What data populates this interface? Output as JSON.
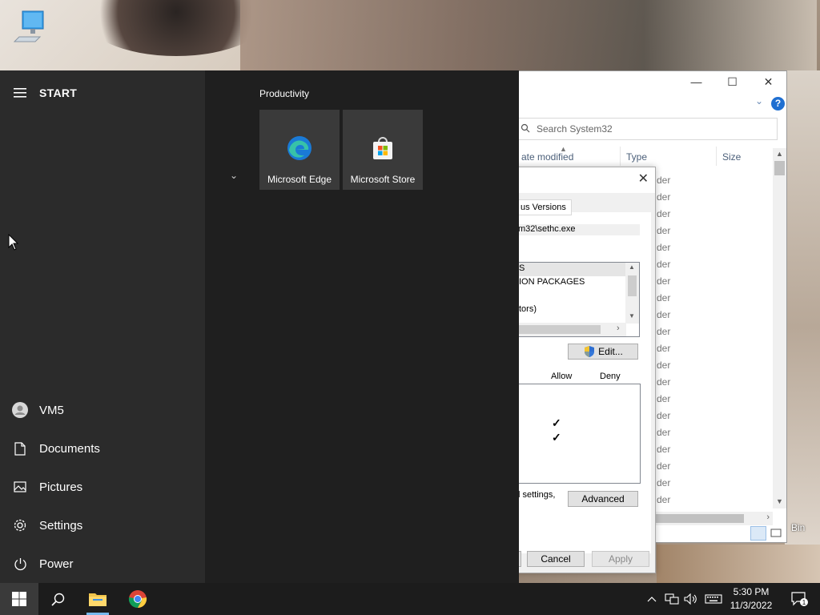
{
  "start_menu": {
    "header_label": "START",
    "group_title": "Productivity",
    "tiles": [
      {
        "label": "Microsoft Edge",
        "icon": "edge-icon"
      },
      {
        "label": "Microsoft Store",
        "icon": "store-icon"
      }
    ],
    "rail_items": [
      {
        "label": "VM5",
        "icon": "user-icon"
      },
      {
        "label": "Documents",
        "icon": "document-icon"
      },
      {
        "label": "Pictures",
        "icon": "pictures-icon"
      },
      {
        "label": "Settings",
        "icon": "gear-icon"
      },
      {
        "label": "Power",
        "icon": "power-icon"
      }
    ]
  },
  "explorer": {
    "search_placeholder": "Search System32",
    "columns": {
      "date_modified": "ate modified",
      "type": "Type",
      "size": "Size"
    },
    "row_text": "der",
    "row_count": 20
  },
  "properties_dialog": {
    "tab_label": "us Versions",
    "object_path": "m32\\sethc.exe",
    "groups": [
      "S",
      "ION PACKAGES",
      "",
      "tors)"
    ],
    "edit_button": "Edit...",
    "perm_headers": {
      "allow": "Allow",
      "deny": "Deny"
    },
    "checkmarks": [
      "✓",
      "✓"
    ],
    "special_text": "l settings,",
    "advanced_button": "Advanced",
    "cancel_button": "Cancel",
    "apply_button": "Apply"
  },
  "desktop": {
    "recycle_bin_label": "Bin"
  },
  "taskbar": {
    "time": "5:30 PM",
    "date": "11/3/2022",
    "notification_count": "1"
  }
}
